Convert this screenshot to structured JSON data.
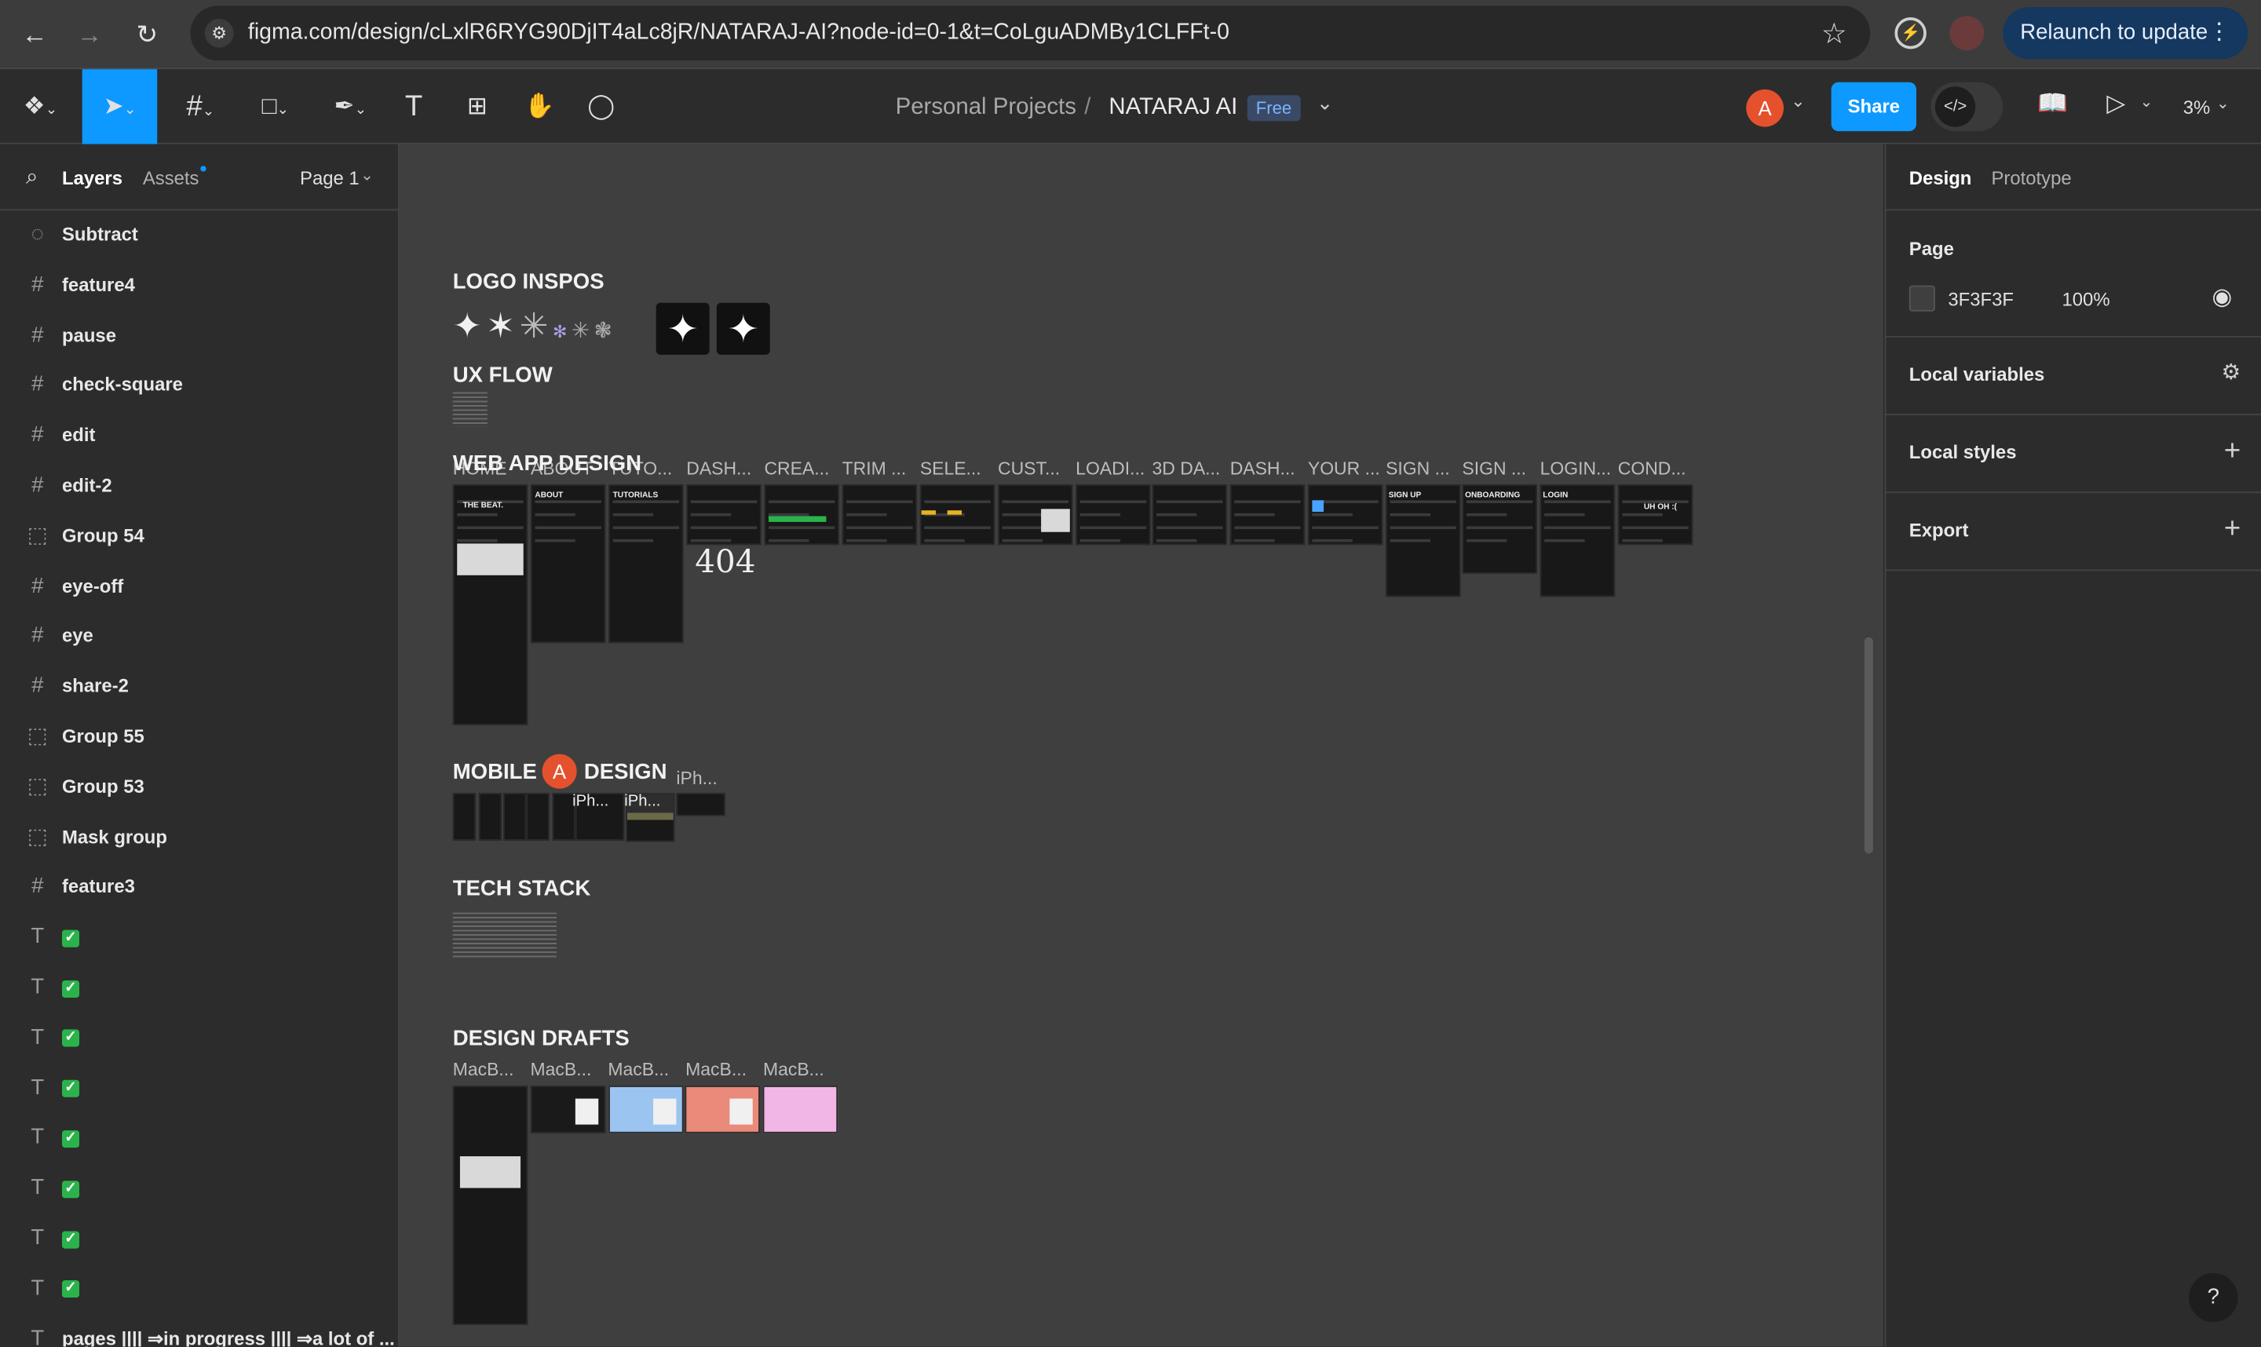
{
  "browser": {
    "url": "figma.com/design/cLxlR6RYG90DjIT4aLc8jR/NATARAJ-AI?node-id=0-1&t=CoLguADMBy1CLFFt-0",
    "relaunch_label": "Relaunch to update"
  },
  "header": {
    "project": "Personal Projects",
    "separator": "/",
    "file_name": "NATARAJ AI",
    "plan_badge": "Free",
    "avatar_initial": "A",
    "share_label": "Share",
    "zoom": "3%"
  },
  "left_panel": {
    "tabs": [
      "Layers",
      "Assets"
    ],
    "page_selector": "Page 1",
    "layers": [
      {
        "icon": "subtract-icon",
        "glyph": "◌",
        "label": "Subtract"
      },
      {
        "icon": "frame-icon",
        "glyph": "#",
        "label": "feature4"
      },
      {
        "icon": "frame-icon",
        "glyph": "#",
        "label": "pause"
      },
      {
        "icon": "frame-icon",
        "glyph": "#",
        "label": "check-square"
      },
      {
        "icon": "frame-icon",
        "glyph": "#",
        "label": "edit"
      },
      {
        "icon": "frame-icon",
        "glyph": "#",
        "label": "edit-2"
      },
      {
        "icon": "group-icon",
        "glyph": "⬚",
        "label": "Group 54"
      },
      {
        "icon": "frame-icon",
        "glyph": "#",
        "label": "eye-off"
      },
      {
        "icon": "frame-icon",
        "glyph": "#",
        "label": "eye"
      },
      {
        "icon": "frame-icon",
        "glyph": "#",
        "label": "share-2"
      },
      {
        "icon": "group-icon",
        "glyph": "⬚",
        "label": "Group 55"
      },
      {
        "icon": "group-icon",
        "glyph": "⬚",
        "label": "Group 53"
      },
      {
        "icon": "group-icon",
        "glyph": "⬚",
        "label": "Mask group"
      },
      {
        "icon": "frame-icon",
        "glyph": "#",
        "label": "feature3"
      },
      {
        "icon": "text-icon",
        "glyph": "T",
        "label": "✅"
      },
      {
        "icon": "text-icon",
        "glyph": "T",
        "label": "✅"
      },
      {
        "icon": "text-icon",
        "glyph": "T",
        "label": "✅"
      },
      {
        "icon": "text-icon",
        "glyph": "T",
        "label": "✅"
      },
      {
        "icon": "text-icon",
        "glyph": "T",
        "label": "✅"
      },
      {
        "icon": "text-icon",
        "glyph": "T",
        "label": "✅"
      },
      {
        "icon": "text-icon",
        "glyph": "T",
        "label": "✅"
      },
      {
        "icon": "text-icon",
        "glyph": "T",
        "label": "✅"
      },
      {
        "icon": "text-icon",
        "glyph": "T",
        "label": "pages |||| ⇒in progress |||| ⇒a lot of ..."
      }
    ]
  },
  "canvas": {
    "sections": {
      "logo": "LOGO INSPOS",
      "ux": "UX FLOW",
      "web": "WEB APP DESIGN",
      "mobile": "MOBILE",
      "mobile_rest": "DESIGN",
      "tech": "TECH STACK",
      "drafts": "DESIGN DRAFTS"
    },
    "web_frame_labels": [
      "HOME",
      "ABOUT",
      "TUTO...",
      "DASH...",
      "CREA...",
      "TRIM ...",
      "SELE...",
      "CUST...",
      "LOADI...",
      "3D DA...",
      "DASH...",
      "YOUR ...",
      "SIGN ...",
      "SIGN ...",
      "LOGIN...",
      "COND..."
    ],
    "web_frame_titles": [
      "THE BEAT.",
      "ABOUT",
      "TUTORIALS",
      "SIGN UP",
      "ONBOARDING",
      "LOGIN",
      "UH OH :("
    ],
    "error_code": "404",
    "mobile_frame_labels": [
      "iPh...",
      "iPh...",
      "iPh..."
    ],
    "draft_labels": [
      "MacB...",
      "MacB...",
      "MacB...",
      "MacB...",
      "MacB..."
    ],
    "collaborator_initial": "A"
  },
  "right_panel": {
    "tabs": [
      "Design",
      "Prototype"
    ],
    "page_heading": "Page",
    "bg_color": "3F3F3F",
    "opacity": "100%",
    "rows": [
      "Local variables",
      "Local styles",
      "Export"
    ]
  },
  "colors": {
    "accent": "#0d99ff",
    "avatar": "#e5512d",
    "canvas": "#3f3f3f",
    "panel": "#2c2c2c"
  }
}
